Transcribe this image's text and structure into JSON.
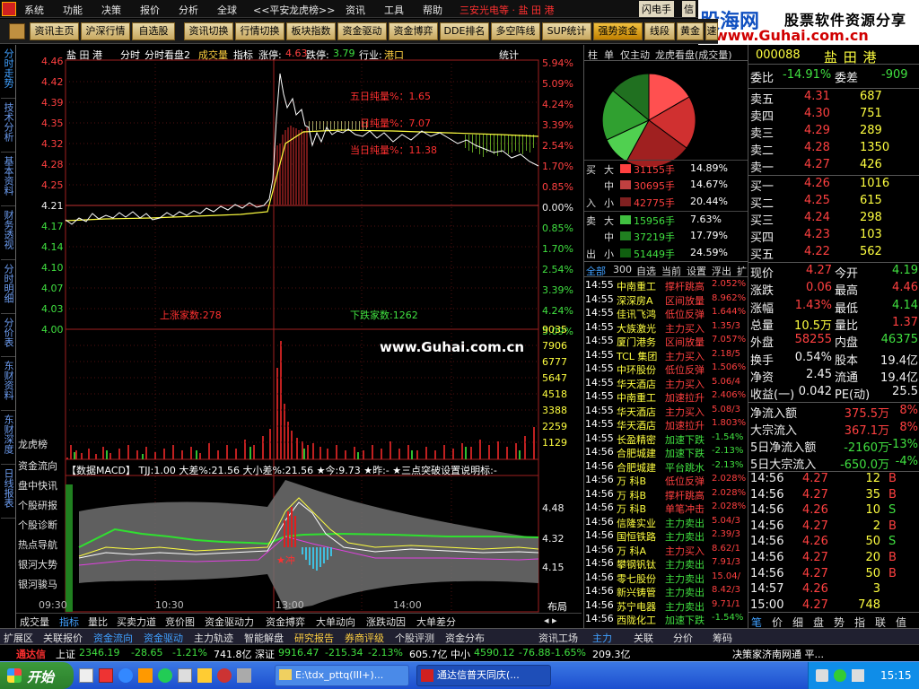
{
  "menubar": {
    "items": [
      "系统",
      "功能",
      "决策",
      "报价",
      "分析",
      "全球",
      "<<平安",
      "龙虎榜>>",
      "资讯",
      "工具",
      "帮助"
    ],
    "marquee": "三安光电等 · 盐 田 港",
    "rightbtn": "闪电手",
    "rightbtn2": "信"
  },
  "banner": {
    "logo": "股海网",
    "slogan": "股票软件资源分享",
    "url": "www.Guhai.com.cn"
  },
  "toolbar": {
    "items": [
      "资讯主页",
      "沪深行情",
      "自选股",
      "资讯切换",
      "行情切换",
      "板块指数",
      "资金驱动",
      "资金博弈",
      "DDE排名",
      "多空阵线",
      "SUP统计",
      "强势资金",
      "线段",
      "黄金",
      "速"
    ]
  },
  "lefttabs": [
    "分时走势",
    "技术分析",
    "基本资料",
    "财务透视",
    "分时明细",
    "分价表",
    "东财资料",
    "东财深度",
    "日线报表"
  ],
  "chart": {
    "header": {
      "name": "盐 田 港",
      "mode": "分时",
      "mode2": "分时看盘2",
      "i1": "成交量",
      "i2": "指标",
      "up": "涨停:",
      "upv": "4.63",
      "down": "跌停:",
      "downv": "3.79",
      "ind": "行业:",
      "indv": "港口",
      "stat": "统计"
    },
    "prices": [
      "4.46",
      "4.42",
      "4.39",
      "4.35",
      "4.32",
      "4.28",
      "4.25",
      "4.21",
      "4.17",
      "4.14",
      "4.10",
      "4.07",
      "4.03",
      "4.00"
    ],
    "pcts": [
      "5.94%",
      "5.09%",
      "4.24%",
      "3.39%",
      "2.54%",
      "1.70%",
      "0.85%",
      "0.00%",
      "0.85%",
      "1.70%",
      "2.54%",
      "3.39%",
      "4.24%",
      "5.09%"
    ],
    "ann1": "五日纯量%：1.65",
    "ann2": "日纯量%：7.07",
    "ann3": "当日纯量%：11.38",
    "ups": "上涨家数:278",
    "downs": "下跌家数:1262",
    "watermark": "www.Guhai.com.cn",
    "vols": [
      "9035",
      "7906",
      "6777",
      "5647",
      "4518",
      "3388",
      "2259",
      "1129"
    ],
    "macd_header": "【数据MACD】 TJJ:1.00  大差%:21.56  大小差%:21.56  ★今:9.73  ★昨:-  ★三点突破设置说明标:-",
    "macd_vals": [
      "4.48",
      "4.32",
      "4.15"
    ],
    "times": [
      "09:30",
      "10:30",
      "13:00",
      "14:00"
    ],
    "layout": "布局",
    "sidebtns": [
      "龙虎榜",
      "资金流向",
      "盘中快讯",
      "个股研报",
      "个股诊断",
      "热点导航",
      "银河大势",
      "银河骏马"
    ]
  },
  "midpanel": {
    "tabs": [
      "柱",
      "单",
      "仅主动",
      "龙虎看盘(成交量)"
    ],
    "flows": [
      {
        "side": "买",
        "size": "大",
        "vol": "31155手",
        "pct": "14.89%",
        "color": "#ff4040"
      },
      {
        "side": "",
        "size": "中",
        "vol": "30695手",
        "pct": "14.67%",
        "color": "#c04040"
      },
      {
        "side": "入",
        "size": "小",
        "vol": "42775手",
        "pct": "20.44%",
        "color": "#802020"
      },
      {
        "side": "卖",
        "size": "大",
        "vol": "15956手",
        "pct": "7.63%",
        "color": "#40c040"
      },
      {
        "side": "",
        "size": "中",
        "vol": "37219手",
        "pct": "17.79%",
        "color": "#208020"
      },
      {
        "side": "出",
        "size": "小",
        "vol": "51449手",
        "pct": "24.59%",
        "color": "#106010"
      }
    ],
    "listtabs": [
      "全部",
      "300",
      "自选",
      "当前",
      "设置",
      "浮出",
      "扩"
    ],
    "list": [
      [
        "14:55",
        "中南重工",
        "撑杆跳高",
        "2.052%"
      ],
      [
        "14:55",
        "深深房A",
        "区间放量",
        "8.962%"
      ],
      [
        "14:55",
        "佳讯飞鸿",
        "低位反弹",
        "1.644%"
      ],
      [
        "14:55",
        "大族激光",
        "主力买入",
        "1.35/3"
      ],
      [
        "14:55",
        "厦门港务",
        "区间放量",
        "7.057%"
      ],
      [
        "14:55",
        "TCL 集团",
        "主力买入",
        "2.18/5"
      ],
      [
        "14:55",
        "中环股份",
        "低位反弹",
        "1.506%"
      ],
      [
        "14:55",
        "华天酒店",
        "主力买入",
        "5.06/4"
      ],
      [
        "14:55",
        "中南重工",
        "加速拉升",
        "2.406%"
      ],
      [
        "14:55",
        "华天酒店",
        "主力买入",
        "5.08/3"
      ],
      [
        "14:55",
        "华天酒店",
        "加速拉升",
        "1.803%"
      ],
      [
        "14:55",
        "长盈精密",
        "加速下跌",
        "-1.54%"
      ],
      [
        "14:56",
        "合肥城建",
        "加速下跌",
        "-2.13%"
      ],
      [
        "14:56",
        "合肥城建",
        "平台跳水",
        "-2.13%"
      ],
      [
        "14:56",
        "万  科B",
        "低位反弹",
        "2.028%"
      ],
      [
        "14:56",
        "万  科B",
        "撑杆跳高",
        "2.028%"
      ],
      [
        "14:56",
        "万  科B",
        "单笔冲击",
        "2.028%"
      ],
      [
        "14:56",
        "信隆实业",
        "主力卖出",
        "5.04/3"
      ],
      [
        "14:56",
        "国恒铁路",
        "主力卖出",
        "2.39/3"
      ],
      [
        "14:56",
        "万  科A",
        "主力买入",
        "8.62/1"
      ],
      [
        "14:56",
        "攀钢钒钛",
        "主力卖出",
        "7.91/3"
      ],
      [
        "14:56",
        "零七股份",
        "主力卖出",
        "15.04/"
      ],
      [
        "14:56",
        "新兴铸管",
        "主力卖出",
        "8.42/3"
      ],
      [
        "14:56",
        "苏宁电器",
        "主力卖出",
        "9.71/1"
      ],
      [
        "14:56",
        "西陇化工",
        "加速下跌",
        "-1.54%"
      ]
    ]
  },
  "right": {
    "code": "000088",
    "name": "盐 田 港",
    "weibi": "委比",
    "weibiv": "-14.91%",
    "weicha": "委差",
    "weichav": "-909",
    "sells": [
      [
        "卖五",
        "4.31",
        "687"
      ],
      [
        "卖四",
        "4.30",
        "751"
      ],
      [
        "卖三",
        "4.29",
        "289"
      ],
      [
        "卖二",
        "4.28",
        "1350"
      ],
      [
        "卖一",
        "4.27",
        "426"
      ]
    ],
    "buys": [
      [
        "买一",
        "4.26",
        "1016"
      ],
      [
        "买二",
        "4.25",
        "615"
      ],
      [
        "买三",
        "4.24",
        "298"
      ],
      [
        "买四",
        "4.23",
        "103"
      ],
      [
        "买五",
        "4.22",
        "562"
      ]
    ],
    "stats": [
      [
        "现价",
        "4.27",
        "今开",
        "4.19"
      ],
      [
        "涨跌",
        "0.06",
        "最高",
        "4.46"
      ],
      [
        "涨幅",
        "1.43%",
        "最低",
        "4.14"
      ],
      [
        "总量",
        "10.5万",
        "量比",
        "1.37"
      ],
      [
        "外盘",
        "58255",
        "内盘",
        "46375"
      ],
      [
        "换手",
        "0.54%",
        "股本",
        "19.4亿"
      ],
      [
        "净资",
        "2.45",
        "流通",
        "19.4亿"
      ],
      [
        "收益(一)",
        "0.042",
        "PE(动)",
        "25.5"
      ]
    ],
    "flows": [
      [
        "净流入额",
        "375.5万",
        "8%"
      ],
      [
        "大宗流入",
        "367.1万",
        "8%"
      ],
      [
        "5日净流入额",
        "-2160万",
        "-13%"
      ],
      [
        "5日大宗流入",
        "-650.0万",
        "-4%"
      ]
    ],
    "ticks": [
      [
        "14:56",
        "4.27",
        "12",
        "B"
      ],
      [
        "14:56",
        "4.27",
        "35",
        "B"
      ],
      [
        "14:56",
        "4.26",
        "10",
        "S"
      ],
      [
        "14:56",
        "4.27",
        "2",
        "B"
      ],
      [
        "14:56",
        "4.26",
        "50",
        "S"
      ],
      [
        "14:56",
        "4.27",
        "20",
        "B"
      ],
      [
        "14:56",
        "4.27",
        "50",
        "B"
      ],
      [
        "14:57",
        "4.26",
        "3",
        ""
      ],
      [
        "15:00",
        "4.27",
        "748",
        ""
      ]
    ],
    "bottomtabs": [
      "笔",
      "价",
      "细",
      "盘",
      "势",
      "指",
      "联",
      "值"
    ]
  },
  "bottomtabs": [
    "成交量",
    "指标",
    "量比",
    "买卖力道",
    "竞价图",
    "资金驱动力",
    "资金搏弈",
    "大单动向",
    "涨跌动因",
    "大单差分"
  ],
  "funcbar": {
    "items": [
      "扩展区",
      "关联报价",
      "资金流向",
      "资金驱动",
      "主力轨迹",
      "智能解盘",
      "研究报告",
      "券商评级",
      "个股评测",
      "资金分布"
    ],
    "right": [
      "资讯工场",
      "主力",
      "关联",
      "分价",
      "筹码"
    ],
    "far": "决策家济南网通 平..."
  },
  "statusbar": {
    "label": "通达信",
    "sh": "上证",
    "shv": "2346.19",
    "shc": "-28.65",
    "shp": "-1.21%",
    "sha": "741.8亿",
    "sz": "深证",
    "szv": "9916.47",
    "szc": "-215.34",
    "szp": "-2.13%",
    "sza": "605.7亿",
    "zx": "中小",
    "zxv": "4590.12",
    "zxc": "-76.88",
    "zxp": "-1.65%",
    "zxa": "209.3亿"
  },
  "taskbar": {
    "start": "开始",
    "task1": "E:\\tdx_pttq(III+)...",
    "task2": "通达信普天同庆(...",
    "clock": "15:15"
  }
}
